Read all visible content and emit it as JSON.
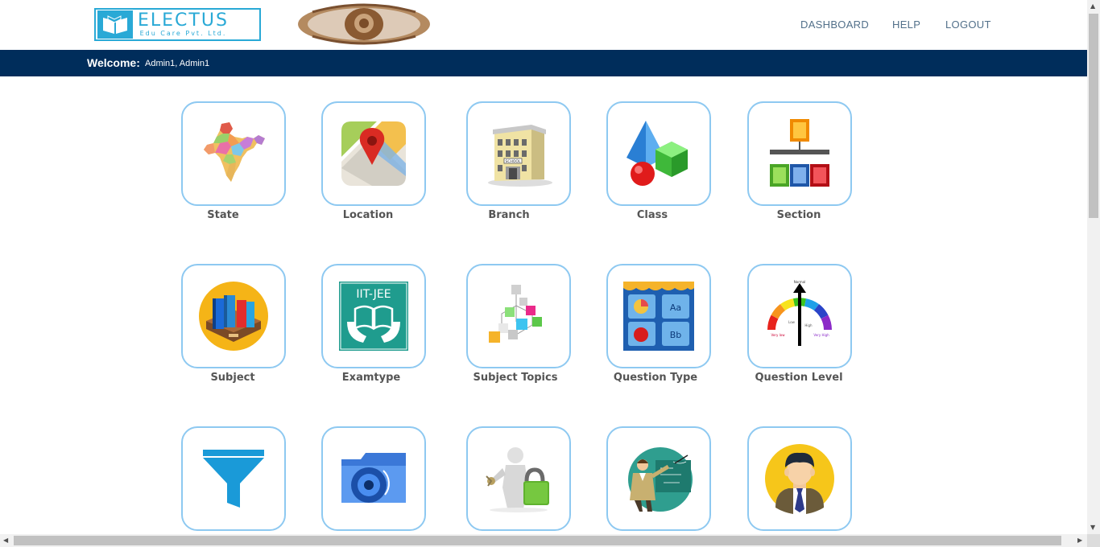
{
  "header": {
    "logo_name": "ELECTUS",
    "logo_sub": "Edu Care Pvt. Ltd.",
    "nav": [
      "DASHBOARD",
      "HELP",
      "LOGOUT"
    ]
  },
  "welcome": {
    "label": "Welcome:",
    "user": "Admin1, Admin1"
  },
  "tiles": [
    {
      "label": "State",
      "icon": "india-map-icon"
    },
    {
      "label": "Location",
      "icon": "map-pin-icon"
    },
    {
      "label": "Branch",
      "icon": "school-building-icon"
    },
    {
      "label": "Class",
      "icon": "3d-shapes-icon"
    },
    {
      "label": "Section",
      "icon": "hierarchy-icon"
    },
    {
      "label": "Subject",
      "icon": "books-icon"
    },
    {
      "label": "Examtype",
      "icon": "iit-jee-book-icon"
    },
    {
      "label": "Subject Topics",
      "icon": "topic-cubes-icon"
    },
    {
      "label": "Question Type",
      "icon": "question-type-icon"
    },
    {
      "label": "Question Level",
      "icon": "difficulty-gauge-icon"
    },
    {
      "label": "",
      "icon": "filter-funnel-icon"
    },
    {
      "label": "",
      "icon": "folder-camera-icon"
    },
    {
      "label": "",
      "icon": "key-lock-user-icon"
    },
    {
      "label": "",
      "icon": "teacher-icon"
    },
    {
      "label": "",
      "icon": "student-avatar-icon"
    }
  ],
  "tile_iit_text": "IIT-JEE",
  "school_sign": "SCHOOL",
  "qtype": {
    "a": "Aa",
    "b": "Bb"
  },
  "level_labels": {
    "top": "Normal",
    "left": "Very low",
    "right": "Very High",
    "mid_low": "Low",
    "mid_high": "High"
  }
}
